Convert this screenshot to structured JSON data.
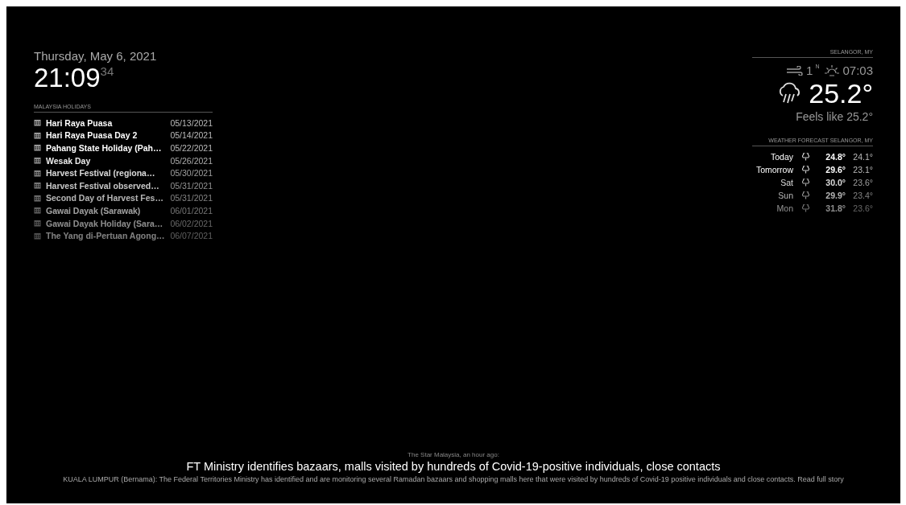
{
  "clock": {
    "date": "Thursday, May 6, 2021",
    "time": "21:09",
    "seconds": "34"
  },
  "holidays": {
    "header": "MALAYSIA HOLIDAYS",
    "events": [
      {
        "title": "Hari Raya Puasa",
        "date": "05/13/2021"
      },
      {
        "title": "Hari Raya Puasa Day 2",
        "date": "05/14/2021"
      },
      {
        "title": "Pahang State Holiday (Pah…",
        "date": "05/22/2021"
      },
      {
        "title": "Wesak Day",
        "date": "05/26/2021"
      },
      {
        "title": "Harvest Festival (regiona…",
        "date": "05/30/2021"
      },
      {
        "title": "Harvest Festival observed…",
        "date": "05/31/2021"
      },
      {
        "title": "Second Day of Harvest Fes…",
        "date": "05/31/2021"
      },
      {
        "title": "Gawai Dayak (Sarawak)",
        "date": "06/01/2021"
      },
      {
        "title": "Gawai Dayak Holiday (Sara…",
        "date": "06/02/2021"
      },
      {
        "title": "The Yang di-Pertuan Agong…",
        "date": "06/07/2021"
      }
    ]
  },
  "current_weather": {
    "header": "SELANGOR, MY",
    "wind_speed": "1",
    "wind_direction": "N",
    "sunrise": "07:03",
    "temperature": "25.2°",
    "feels_like": "Feels like 25.2°"
  },
  "forecast": {
    "header": "WEATHER FORECAST SELANGOR, MY",
    "days": [
      {
        "day": "Today",
        "high": "24.8°",
        "low": "24.1°"
      },
      {
        "day": "Tomorrow",
        "high": "29.6°",
        "low": "23.1°"
      },
      {
        "day": "Sat",
        "high": "30.0°",
        "low": "23.6°"
      },
      {
        "day": "Sun",
        "high": "29.9°",
        "low": "23.4°"
      },
      {
        "day": "Mon",
        "high": "31.8°",
        "low": "23.6°"
      }
    ]
  },
  "news": {
    "source": "The Star Malaysia, an hour ago:",
    "headline": "FT Ministry identifies bazaars, malls visited by hundreds of Covid-19-positive individuals, close contacts",
    "description": "KUALA LUMPUR (Bernama): The Federal Territories Ministry has identified and are monitoring several Ramadan bazaars and shopping malls here that were visited by hundreds of Covid-19 positive individuals and close contacts. Read full story"
  }
}
